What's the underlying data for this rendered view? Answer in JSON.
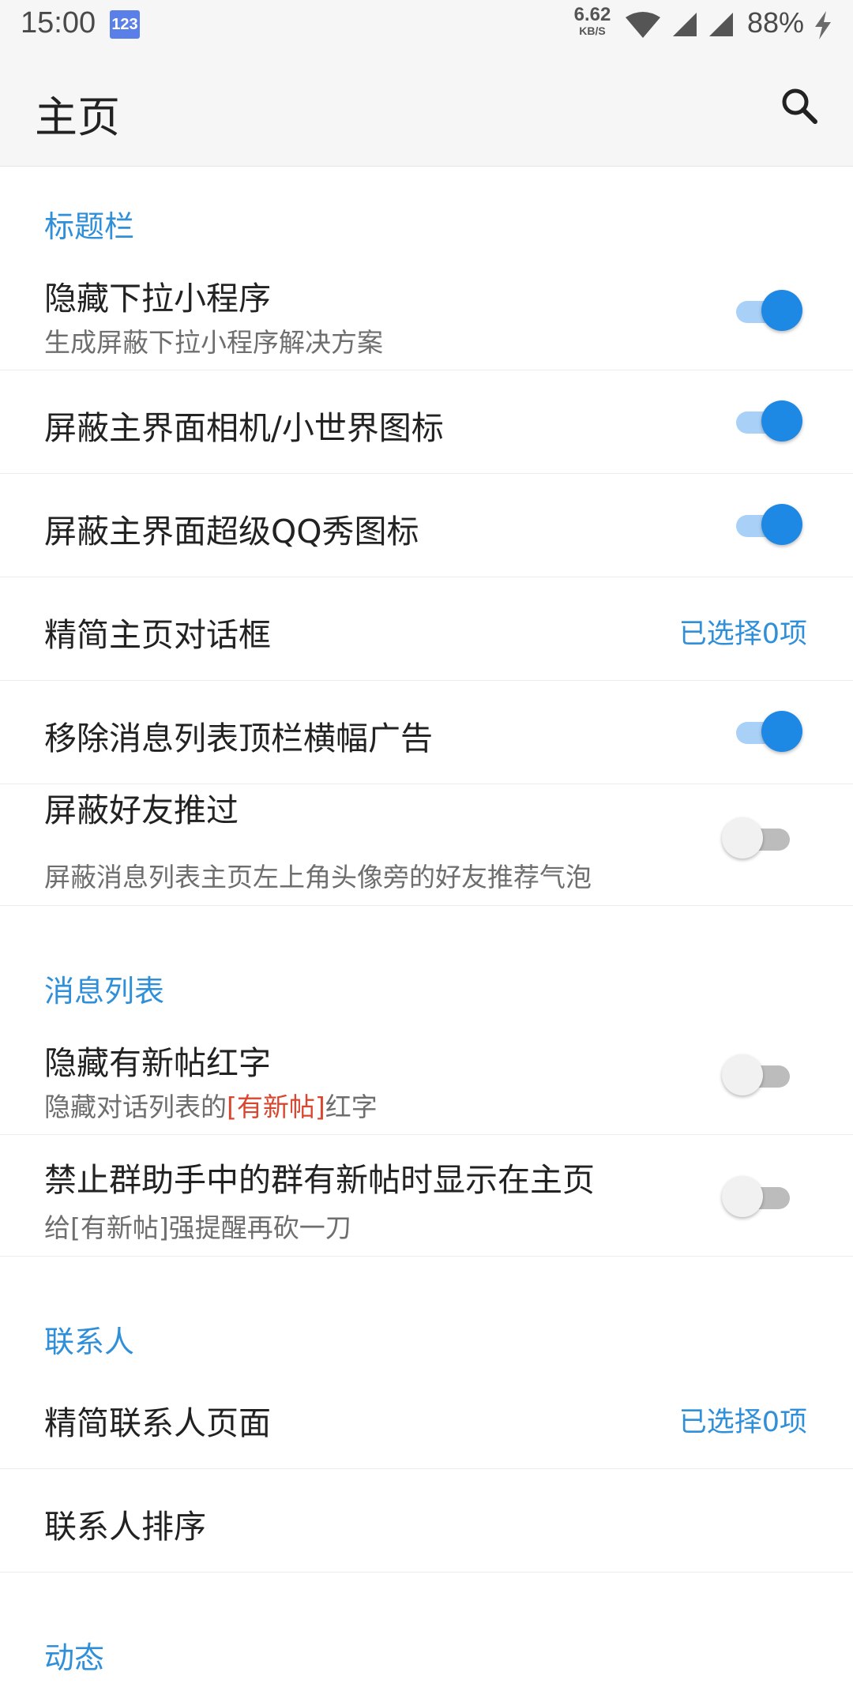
{
  "status_bar": {
    "time": "15:00",
    "badge": "123",
    "speed_value": "6.62",
    "speed_unit": "KB/S",
    "battery": "88%"
  },
  "header": {
    "title": "主页"
  },
  "colors": {
    "accent": "#2f8fd9",
    "toggle_on": "#1e88e5",
    "highlight": "#d9462f"
  },
  "sections": [
    {
      "title": "标题栏",
      "items": [
        {
          "title": "隐藏下拉小程序",
          "subtitle": "生成屏蔽下拉小程序解决方案",
          "toggle": true
        },
        {
          "title": "屏蔽主界面相机/小世界图标",
          "toggle": true
        },
        {
          "title": "屏蔽主界面超级QQ秀图标",
          "toggle": true
        },
        {
          "title": "精简主页对话框",
          "value": "已选择0项"
        },
        {
          "title": "移除消息列表顶栏横幅广告",
          "toggle": true
        },
        {
          "title": "屏蔽好友推过",
          "subtitle": "屏蔽消息列表主页左上角头像旁的好友推荐气泡",
          "toggle": false
        }
      ]
    },
    {
      "title": "消息列表",
      "items": [
        {
          "title": "隐藏有新帖红字",
          "subtitle_prefix": "隐藏对话列表的",
          "subtitle_highlight": "[有新帖]",
          "subtitle_suffix": "红字",
          "toggle": false
        },
        {
          "title": "禁止群助手中的群有新帖时显示在主页",
          "subtitle": "给[有新帖]强提醒再砍一刀",
          "toggle": false
        }
      ]
    },
    {
      "title": "联系人",
      "items": [
        {
          "title": "精简联系人页面",
          "value": "已选择0项"
        },
        {
          "title": "联系人排序"
        }
      ]
    },
    {
      "title": "动态",
      "items": []
    }
  ]
}
